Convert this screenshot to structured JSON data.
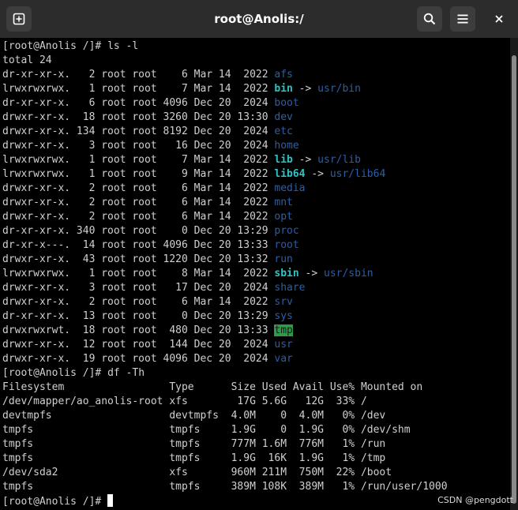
{
  "window": {
    "title": "root@Anolis:/"
  },
  "icons": {
    "new_tab": "new-tab-icon",
    "search": "search-icon",
    "menu": "hamburger-menu-icon",
    "close": "close-icon"
  },
  "colors": {
    "directory": "#2a5fa8",
    "symlink": "#2ec4c4",
    "sticky_dir_bg": "#2e9a4a"
  },
  "terminal": {
    "prompt": "[root@Anolis /]# ",
    "ls_command": "ls -l",
    "ls_total": "total 24",
    "ls_entries": [
      {
        "perms": "dr-xr-xr-x.",
        "links": "2",
        "owner": "root",
        "group": "root",
        "size": "6",
        "month": "Mar",
        "day": "14",
        "time": "2022",
        "name": "afs",
        "type": "dir"
      },
      {
        "perms": "lrwxrwxrwx.",
        "links": "1",
        "owner": "root",
        "group": "root",
        "size": "7",
        "month": "Mar",
        "day": "14",
        "time": "2022",
        "name": "bin",
        "type": "link",
        "target": "usr/bin"
      },
      {
        "perms": "dr-xr-xr-x.",
        "links": "6",
        "owner": "root",
        "group": "root",
        "size": "4096",
        "month": "Dec",
        "day": "20",
        "time": "2024",
        "name": "boot",
        "type": "dir"
      },
      {
        "perms": "drwxr-xr-x.",
        "links": "18",
        "owner": "root",
        "group": "root",
        "size": "3260",
        "month": "Dec",
        "day": "20",
        "time": "13:30",
        "name": "dev",
        "type": "dir"
      },
      {
        "perms": "drwxr-xr-x.",
        "links": "134",
        "owner": "root",
        "group": "root",
        "size": "8192",
        "month": "Dec",
        "day": "20",
        "time": "2024",
        "name": "etc",
        "type": "dir"
      },
      {
        "perms": "drwxr-xr-x.",
        "links": "3",
        "owner": "root",
        "group": "root",
        "size": "16",
        "month": "Dec",
        "day": "20",
        "time": "2024",
        "name": "home",
        "type": "dir"
      },
      {
        "perms": "lrwxrwxrwx.",
        "links": "1",
        "owner": "root",
        "group": "root",
        "size": "7",
        "month": "Mar",
        "day": "14",
        "time": "2022",
        "name": "lib",
        "type": "link",
        "target": "usr/lib"
      },
      {
        "perms": "lrwxrwxrwx.",
        "links": "1",
        "owner": "root",
        "group": "root",
        "size": "9",
        "month": "Mar",
        "day": "14",
        "time": "2022",
        "name": "lib64",
        "type": "link",
        "target": "usr/lib64"
      },
      {
        "perms": "drwxr-xr-x.",
        "links": "2",
        "owner": "root",
        "group": "root",
        "size": "6",
        "month": "Mar",
        "day": "14",
        "time": "2022",
        "name": "media",
        "type": "dir"
      },
      {
        "perms": "drwxr-xr-x.",
        "links": "2",
        "owner": "root",
        "group": "root",
        "size": "6",
        "month": "Mar",
        "day": "14",
        "time": "2022",
        "name": "mnt",
        "type": "dir"
      },
      {
        "perms": "drwxr-xr-x.",
        "links": "2",
        "owner": "root",
        "group": "root",
        "size": "6",
        "month": "Mar",
        "day": "14",
        "time": "2022",
        "name": "opt",
        "type": "dir"
      },
      {
        "perms": "dr-xr-xr-x.",
        "links": "340",
        "owner": "root",
        "group": "root",
        "size": "0",
        "month": "Dec",
        "day": "20",
        "time": "13:29",
        "name": "proc",
        "type": "dir"
      },
      {
        "perms": "dr-xr-x---.",
        "links": "14",
        "owner": "root",
        "group": "root",
        "size": "4096",
        "month": "Dec",
        "day": "20",
        "time": "13:33",
        "name": "root",
        "type": "dir"
      },
      {
        "perms": "drwxr-xr-x.",
        "links": "43",
        "owner": "root",
        "group": "root",
        "size": "1220",
        "month": "Dec",
        "day": "20",
        "time": "13:32",
        "name": "run",
        "type": "dir"
      },
      {
        "perms": "lrwxrwxrwx.",
        "links": "1",
        "owner": "root",
        "group": "root",
        "size": "8",
        "month": "Mar",
        "day": "14",
        "time": "2022",
        "name": "sbin",
        "type": "link",
        "target": "usr/sbin"
      },
      {
        "perms": "drwxr-xr-x.",
        "links": "3",
        "owner": "root",
        "group": "root",
        "size": "17",
        "month": "Dec",
        "day": "20",
        "time": "2024",
        "name": "share",
        "type": "dir"
      },
      {
        "perms": "drwxr-xr-x.",
        "links": "2",
        "owner": "root",
        "group": "root",
        "size": "6",
        "month": "Mar",
        "day": "14",
        "time": "2022",
        "name": "srv",
        "type": "dir"
      },
      {
        "perms": "dr-xr-xr-x.",
        "links": "13",
        "owner": "root",
        "group": "root",
        "size": "0",
        "month": "Dec",
        "day": "20",
        "time": "13:29",
        "name": "sys",
        "type": "dir"
      },
      {
        "perms": "drwxrwxrwt.",
        "links": "18",
        "owner": "root",
        "group": "root",
        "size": "480",
        "month": "Dec",
        "day": "20",
        "time": "13:33",
        "name": "tmp",
        "type": "sticky"
      },
      {
        "perms": "drwxr-xr-x.",
        "links": "12",
        "owner": "root",
        "group": "root",
        "size": "144",
        "month": "Dec",
        "day": "20",
        "time": "2024",
        "name": "usr",
        "type": "dir"
      },
      {
        "perms": "drwxr-xr-x.",
        "links": "19",
        "owner": "root",
        "group": "root",
        "size": "4096",
        "month": "Dec",
        "day": "20",
        "time": "2024",
        "name": "var",
        "type": "dir"
      }
    ],
    "df_command": "df -Th",
    "df_header": [
      "Filesystem",
      "Type",
      "Size",
      "Used",
      "Avail",
      "Use%",
      "Mounted on"
    ],
    "df_rows": [
      [
        "/dev/mapper/ao_anolis-root",
        "xfs",
        "17G",
        "5.6G",
        "12G",
        "33%",
        "/"
      ],
      [
        "devtmpfs",
        "devtmpfs",
        "4.0M",
        "0",
        "4.0M",
        "0%",
        "/dev"
      ],
      [
        "tmpfs",
        "tmpfs",
        "1.9G",
        "0",
        "1.9G",
        "0%",
        "/dev/shm"
      ],
      [
        "tmpfs",
        "tmpfs",
        "777M",
        "1.6M",
        "776M",
        "1%",
        "/run"
      ],
      [
        "tmpfs",
        "tmpfs",
        "1.9G",
        "16K",
        "1.9G",
        "1%",
        "/tmp"
      ],
      [
        "/dev/sda2",
        "xfs",
        "960M",
        "211M",
        "750M",
        "22%",
        "/boot"
      ],
      [
        "tmpfs",
        "tmpfs",
        "389M",
        "108K",
        "389M",
        "1%",
        "/run/user/1000"
      ]
    ]
  },
  "watermark": "CSDN @pengdott"
}
